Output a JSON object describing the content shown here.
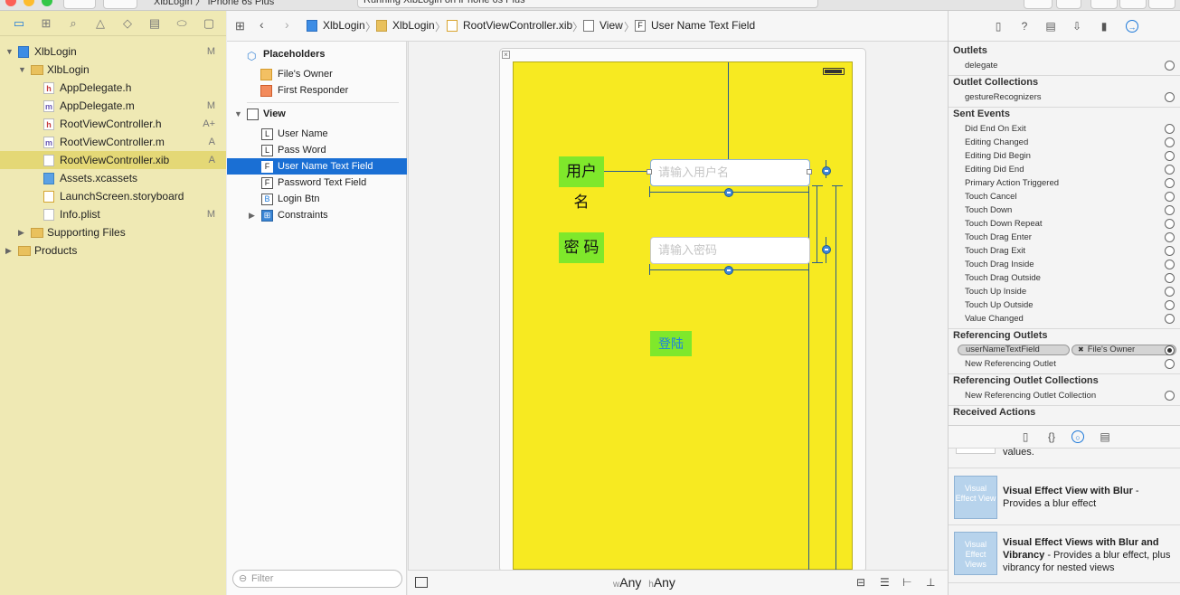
{
  "window": {
    "scheme": "XlbLogin 〉 iPhone 6s Plus",
    "status": "Running XlbLogin on iPhone 6s Plus"
  },
  "navigator": {
    "rows": [
      {
        "label": "XlbLogin",
        "badge": "M",
        "icon": "project-icon"
      },
      {
        "label": "XlbLogin",
        "badge": "",
        "icon": "folder-icon"
      },
      {
        "label": "AppDelegate.h",
        "badge": "",
        "icon": "header-file-icon"
      },
      {
        "label": "AppDelegate.m",
        "badge": "M",
        "icon": "implementation-file-icon"
      },
      {
        "label": "RootViewController.h",
        "badge": "A+",
        "icon": "header-file-icon"
      },
      {
        "label": "RootViewController.m",
        "badge": "A",
        "icon": "implementation-file-icon"
      },
      {
        "label": "RootViewController.xib",
        "badge": "A",
        "icon": "xib-file-icon"
      },
      {
        "label": "Assets.xcassets",
        "badge": "",
        "icon": "assets-icon"
      },
      {
        "label": "LaunchScreen.storyboard",
        "badge": "",
        "icon": "storyboard-icon"
      },
      {
        "label": "Info.plist",
        "badge": "M",
        "icon": "plist-icon"
      },
      {
        "label": "Supporting Files",
        "badge": "",
        "icon": "folder-icon"
      },
      {
        "label": "Products",
        "badge": "",
        "icon": "folder-icon"
      }
    ],
    "selected_index": 6
  },
  "jumpbar": {
    "crumbs": [
      "XlbLogin",
      "XlbLogin",
      "RootViewController.xib",
      "View",
      "User Name Text Field"
    ]
  },
  "outline": {
    "placeholders": "Placeholders",
    "files_owner": "File's Owner",
    "first_responder": "First Responder",
    "view": "View",
    "items": [
      {
        "glyph": "L",
        "label": "User Name"
      },
      {
        "glyph": "L",
        "label": "Pass Word"
      },
      {
        "glyph": "F",
        "label": "User Name Text Field"
      },
      {
        "glyph": "F",
        "label": "Password Text Field"
      },
      {
        "glyph": "B",
        "label": "Login Btn"
      }
    ],
    "selected_index": 2,
    "constraints": "Constraints",
    "filter_placeholder": "Filter"
  },
  "canvas": {
    "username_label": "用户名",
    "password_label": "密  码",
    "username_placeholder": "请输入用户名",
    "password_placeholder": "请输入密码",
    "login_button": "登陆",
    "size_w_prefix": "w",
    "size_w": "Any",
    "size_h_prefix": "h",
    "size_h": "Any"
  },
  "inspector": {
    "outlets_title": "Outlets",
    "outlets": [
      "delegate"
    ],
    "outlet_collections_title": "Outlet Collections",
    "outlet_collections": [
      "gestureRecognizers"
    ],
    "sent_events_title": "Sent Events",
    "sent_events": [
      "Did End On Exit",
      "Editing Changed",
      "Editing Did Begin",
      "Editing Did End",
      "Primary Action Triggered",
      "Touch Cancel",
      "Touch Down",
      "Touch Down Repeat",
      "Touch Drag Enter",
      "Touch Drag Exit",
      "Touch Drag Inside",
      "Touch Drag Outside",
      "Touch Up Inside",
      "Touch Up Outside",
      "Value Changed"
    ],
    "referencing_outlets_title": "Referencing Outlets",
    "connection_outlet": "userNameTextField",
    "connection_target": "File's Owner",
    "new_referencing_outlet": "New Referencing Outlet",
    "referencing_collections_title": "Referencing Outlet Collections",
    "new_referencing_collection": "New Referencing Outlet Collection",
    "received_actions_title": "Received Actions"
  },
  "library": {
    "partial_text": "values.",
    "items": [
      {
        "thumb": "Visual Effect View",
        "title": "Visual Effect View with Blur",
        "desc": " - Provides a blur effect"
      },
      {
        "thumb": "Visual Effect Views",
        "title": "Visual Effect Views with Blur and Vibrancy",
        "desc": " - Provides a blur effect, plus vibrancy for nested views"
      }
    ]
  },
  "colors": {
    "view_background": "#f7ea21",
    "label_background": "#7fe82b",
    "selection": "#1a6fd4",
    "navigator_background": "#efe9b4"
  }
}
